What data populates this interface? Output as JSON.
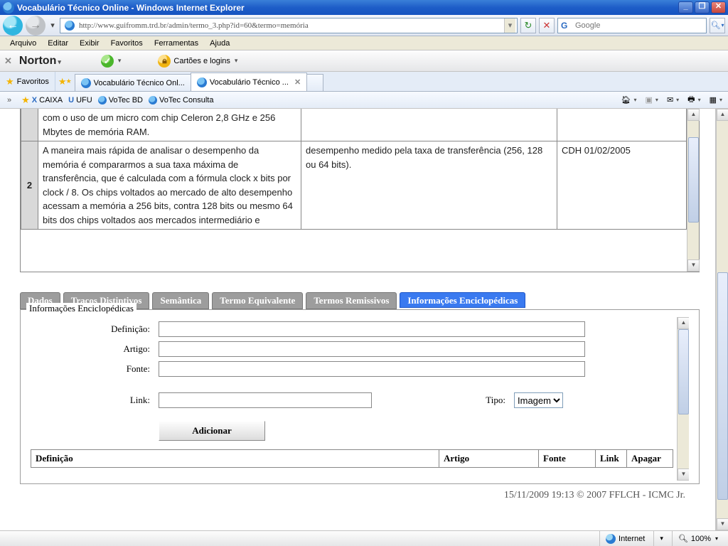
{
  "window": {
    "title": "Vocabulário Técnico Online - Windows Internet Explorer"
  },
  "navbar": {
    "url": "http://www.guifromm.trd.br/admin/termo_3.php?id=60&termo=memória",
    "search_placeholder": "Google"
  },
  "menu": {
    "file": "Arquivo",
    "edit": "Editar",
    "view": "Exibir",
    "favorites": "Favoritos",
    "tools": "Ferramentas",
    "help": "Ajuda"
  },
  "norton": {
    "logo": "Norton",
    "cards": "Cartões e logins"
  },
  "favoritesbar": {
    "label": "Favoritos"
  },
  "tabs": [
    {
      "label": "Vocabulário Técnico Onl..."
    },
    {
      "label": "Vocabulário Técnico ..."
    }
  ],
  "quicklinks": [
    {
      "label": "CAIXA"
    },
    {
      "label": "UFU"
    },
    {
      "label": "VoTec BD"
    },
    {
      "label": "VoTec Consulta"
    }
  ],
  "context_table": {
    "rows": [
      {
        "n": "",
        "text": "com o uso de um micro com chip Celeron 2,8 GHz e 256 Mbytes de memória RAM.",
        "concept": "",
        "meta": ""
      },
      {
        "n": "2",
        "text": "A maneira mais rápida de analisar o desempenho da memória é compararmos a sua taxa máxima de transferência, que é calculada com a fórmula clock x bits por clock / 8. Os chips voltados ao mercado de alto desempenho acessam a memória a 256 bits, contra 128 bits ou mesmo 64 bits dos chips voltados aos mercados intermediário e",
        "concept": "desempenho medido pela taxa de transferência (256, 128 ou 64 bits).",
        "meta": "CDH 01/02/2005"
      }
    ]
  },
  "inner_tabs": {
    "dados": "Dados",
    "tracos": "Traços Distintivos",
    "semantica": "Semântica",
    "termoequiv": "Termo Equivalente",
    "remissivos": "Termos Remissivos",
    "enciclo": "Informações Enciclopédicas"
  },
  "fieldset": {
    "legend": "Informações Enciclopédicas",
    "definicao_label": "Definição:",
    "artigo_label": "Artigo:",
    "fonte_label": "Fonte:",
    "link_label": "Link:",
    "tipo_label": "Tipo:",
    "tipo_value": "Imagem",
    "add_button": "Adicionar",
    "col_definicao": "Definição",
    "col_artigo": "Artigo",
    "col_fonte": "Fonte",
    "col_link": "Link",
    "col_apagar": "Apagar"
  },
  "pagefooter": "15/11/2009 19:13 © 2007 FFLCH - ICMC Jr.",
  "statusbar": {
    "zone": "Internet",
    "zoom": "100%"
  }
}
